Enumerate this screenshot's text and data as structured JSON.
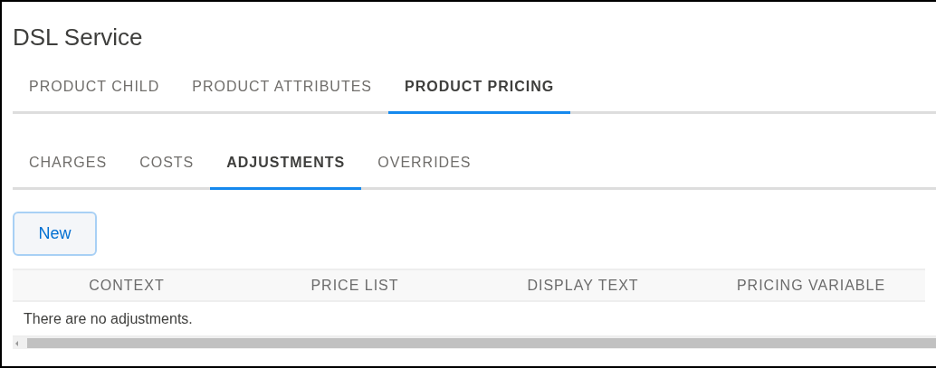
{
  "title": "DSL Service",
  "tabs": [
    {
      "label": "PRODUCT CHILD",
      "selected": false
    },
    {
      "label": "PRODUCT ATTRIBUTES",
      "selected": false
    },
    {
      "label": "PRODUCT PRICING",
      "selected": true
    }
  ],
  "subtabs": [
    {
      "label": "CHARGES",
      "selected": false
    },
    {
      "label": "COSTS",
      "selected": false
    },
    {
      "label": "ADJUSTMENTS",
      "selected": true
    },
    {
      "label": "OVERRIDES",
      "selected": false
    }
  ],
  "new_button": "New",
  "table": {
    "columns": [
      "CONTEXT",
      "PRICE LIST",
      "DISPLAY TEXT",
      "PRICING VARIABLE"
    ],
    "empty_message": "There are no adjustments."
  }
}
